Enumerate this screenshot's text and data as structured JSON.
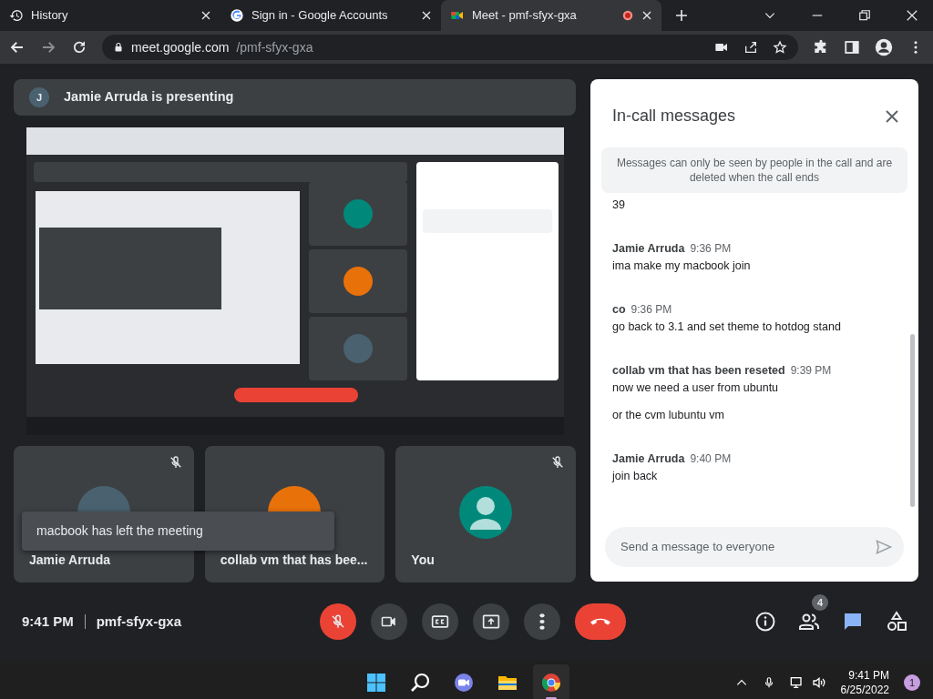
{
  "browser": {
    "tabs": [
      {
        "title": "History",
        "kind": "history",
        "selected": false,
        "recording": false
      },
      {
        "title": "Sign in - Google Accounts",
        "kind": "google",
        "selected": false,
        "recording": false
      },
      {
        "title": "Meet - pmf-sfyx-gxa",
        "kind": "meet",
        "selected": true,
        "recording": true
      }
    ],
    "url_host": "meet.google.com",
    "url_path": "/pmf-sfyx-gxa"
  },
  "presenter": {
    "initial": "J",
    "text": "Jamie Arruda is presenting"
  },
  "tiles": [
    {
      "name": "Jamie Arruda",
      "muted": true,
      "color": "#4a6170"
    },
    {
      "name": "collab vm that has bee...",
      "muted": false,
      "color": "#e8710a"
    },
    {
      "name": "You",
      "muted": true,
      "color": "#00897b"
    }
  ],
  "toast": "macbook has left the meeting",
  "meeting_bar": {
    "time": "9:41 PM",
    "code": "pmf-sfyx-gxa",
    "mic_muted": true,
    "people_count": "4",
    "chat_selected": true
  },
  "chat": {
    "title": "In-call messages",
    "notice": "Messages can only be seen by people in the call and are deleted when the call ends",
    "messages": [
      {
        "texts": [
          "39"
        ]
      },
      {
        "sender": "Jamie Arruda",
        "time": "9:36 PM",
        "texts": [
          "ima make my macbook join"
        ]
      },
      {
        "sender": "co",
        "time": "9:36 PM",
        "texts": [
          "go back to 3.1 and set theme to hotdog stand"
        ]
      },
      {
        "sender": "collab vm that has been reseted",
        "time": "9:39 PM",
        "texts": [
          "now we need a user from ubuntu",
          "or the cvm lubuntu vm"
        ]
      },
      {
        "sender": "Jamie Arruda",
        "time": "9:40 PM",
        "texts": [
          "join back"
        ]
      }
    ],
    "placeholder": "Send a message to everyone"
  },
  "taskbar": {
    "apps": [
      {
        "kind": "start",
        "selected": false
      },
      {
        "kind": "search",
        "selected": false
      },
      {
        "kind": "chat",
        "selected": false
      },
      {
        "kind": "files",
        "selected": false
      },
      {
        "kind": "chrome",
        "selected": true
      }
    ],
    "time": "9:41 PM",
    "date": "6/25/2022",
    "notifications": "1"
  }
}
